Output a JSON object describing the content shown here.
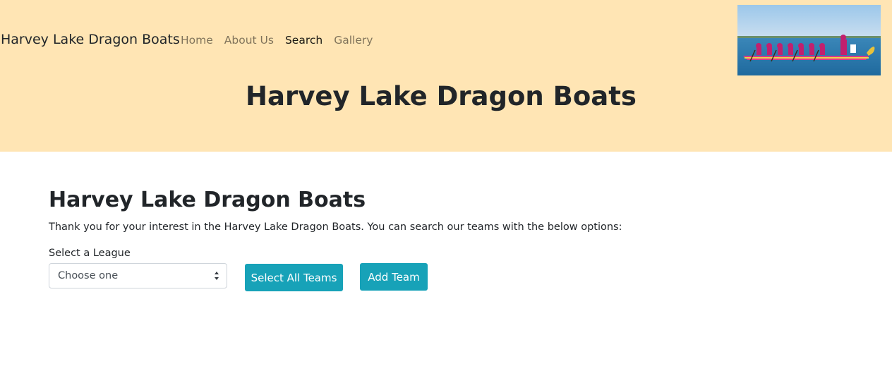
{
  "header": {
    "brand": "Harvey Lake Dragon Boats",
    "nav": [
      {
        "label": "Home",
        "active": false
      },
      {
        "label": "About Us",
        "active": false
      },
      {
        "label": "Search",
        "active": true
      },
      {
        "label": "Gallery",
        "active": false
      }
    ],
    "hero_title": "Harvey Lake Dragon Boats",
    "image_icon": "dragon-boat-photo"
  },
  "main": {
    "heading": "Harvey Lake Dragon Boats",
    "intro": "Thank you for your interest in the Harvey Lake Dragon Boats. You can search our teams with the below options:",
    "league_label": "Select a League",
    "league_select_value": "Choose one",
    "select_all_label": "Select All Teams",
    "add_team_label": "Add Team"
  },
  "colors": {
    "header_bg": "#ffe5b4",
    "button_bg": "#17a2b8",
    "text": "#212529"
  }
}
